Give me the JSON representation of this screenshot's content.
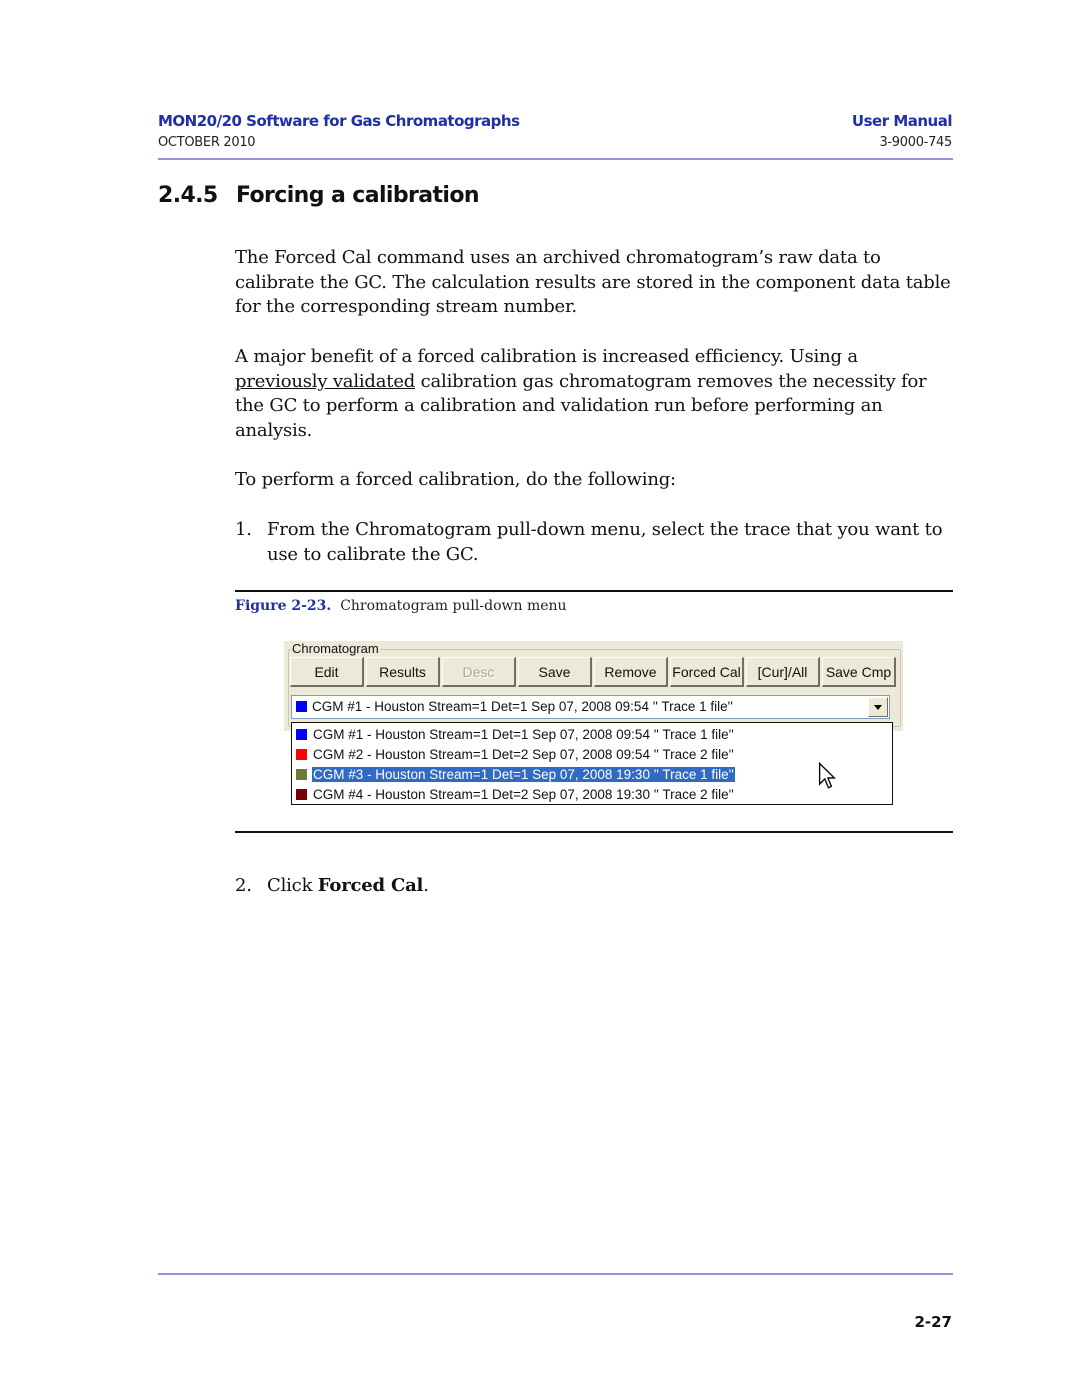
{
  "header": {
    "title": "MON20/20 Software for Gas Chromatographs",
    "manual": "User Manual",
    "date": "OCTOBER 2010",
    "doc_number": "3-9000-745"
  },
  "section": {
    "number": "2.4.5",
    "title": "Forcing a calibration"
  },
  "paragraphs": {
    "p1": "The Forced Cal command uses an archived chromatogram’s raw data to calibrate the GC. The calculation results are stored in the component data table for the corresponding stream number.",
    "p2_start": "A major benefit of a forced calibration is increased efficiency.  Using a ",
    "p2_underlined": "previously validated",
    "p2_end": " calibration gas chromatogram removes the necessity for the GC to perform a calibration and validation run before performing an analysis.",
    "p3": "To perform a forced calibration, do the following:"
  },
  "steps": [
    {
      "number": "1.",
      "text": "From the Chromatogram pull-down menu, select the trace that you want to use to calibrate the GC."
    },
    {
      "number": "2.",
      "text_prefix": "Click ",
      "text_bold": "Forced Cal",
      "text_suffix": "."
    }
  ],
  "figure": {
    "label": "Figure 2-23.",
    "caption": "Chromatogram pull-down menu"
  },
  "dialog": {
    "group_label": "Chromatogram",
    "buttons": [
      {
        "label": "Edit",
        "enabled": true
      },
      {
        "label": "Results",
        "enabled": true
      },
      {
        "label": "Desc",
        "enabled": false
      },
      {
        "label": "Save",
        "enabled": true
      },
      {
        "label": "Remove",
        "enabled": true
      },
      {
        "label": "Forced Cal",
        "enabled": true
      },
      {
        "label": "[Cur]/All",
        "enabled": true
      },
      {
        "label": "Save Cmp",
        "enabled": true
      }
    ],
    "combo": {
      "selected_text": "CGM #1 - Houston Stream=1 Det=1 Sep 07, 2008 09:54 '' Trace 1 file''",
      "selected_color": "#0000ff",
      "dropdown_icon": "chevron-down-icon"
    },
    "options": [
      {
        "text": "CGM #1 - Houston Stream=1 Det=1 Sep 07, 2008 09:54 '' Trace 1 file''",
        "color": "#0000ff",
        "highlighted": false
      },
      {
        "text": "CGM #2 - Houston Stream=1 Det=2 Sep 07, 2008 09:54 '' Trace 2 file''",
        "color": "#ff0000",
        "highlighted": false
      },
      {
        "text": "CGM #3 - Houston Stream=1 Det=1 Sep 07, 2008 19:30 '' Trace 1 file''",
        "color": "#6b7a33",
        "highlighted": true
      },
      {
        "text": "CGM #4 - Houston Stream=1 Det=2 Sep 07, 2008 19:30 '' Trace 2 file''",
        "color": "#7a0000",
        "highlighted": false
      }
    ],
    "highlight_color": "#316ac5",
    "cursor_icon": "mouse-pointer-icon"
  },
  "footer": {
    "page_number": "2-27"
  }
}
